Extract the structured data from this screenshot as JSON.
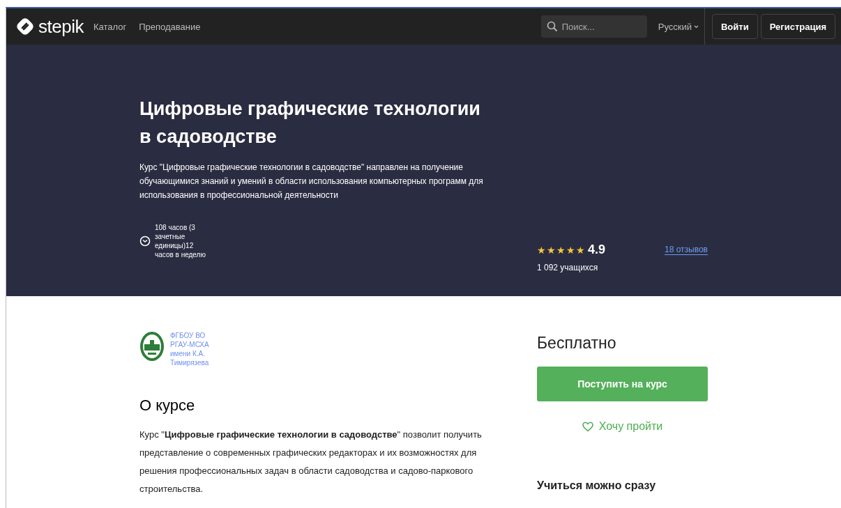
{
  "header": {
    "logo": "stepik",
    "nav": [
      {
        "label": "Каталог"
      },
      {
        "label": "Преподавание"
      }
    ],
    "search": {
      "placeholder": "Поиск..."
    },
    "language": "Русский",
    "buttons": [
      "Войти",
      "Регистрация"
    ]
  },
  "hero": {
    "title": "Цифровые графические технологии в садоводстве",
    "description": "Курс \"Цифровые графические технологии в садоводстве\" направлен на получение обучающимися знаний и умений в области использования компьютерных программ для использования в профессиональной деятельности",
    "duration": "108 часов (3 зачетные единицы)12 часов в неделю",
    "stars": 5,
    "rating": "4.9",
    "reviews": "18 отзывов",
    "learners": "1 092 учащихся"
  },
  "author": {
    "name": "ФГБОУ ВО РГАУ-МСХА имени К.А. Тимирязева"
  },
  "about": {
    "heading": "О курсе",
    "text": "Курс \"**Цифровые графические технологии в садоводстве**\" позволит получить представление о современных графических редакторах и их возможностях для решения профессиональных задач в области садоводства и садово-паркового строительства."
  },
  "enroll": {
    "price": "Бесплатно",
    "button": "Поступить на курс",
    "wishlist": "Хочу пройти",
    "subheading": "Учиться можно сразу"
  }
}
